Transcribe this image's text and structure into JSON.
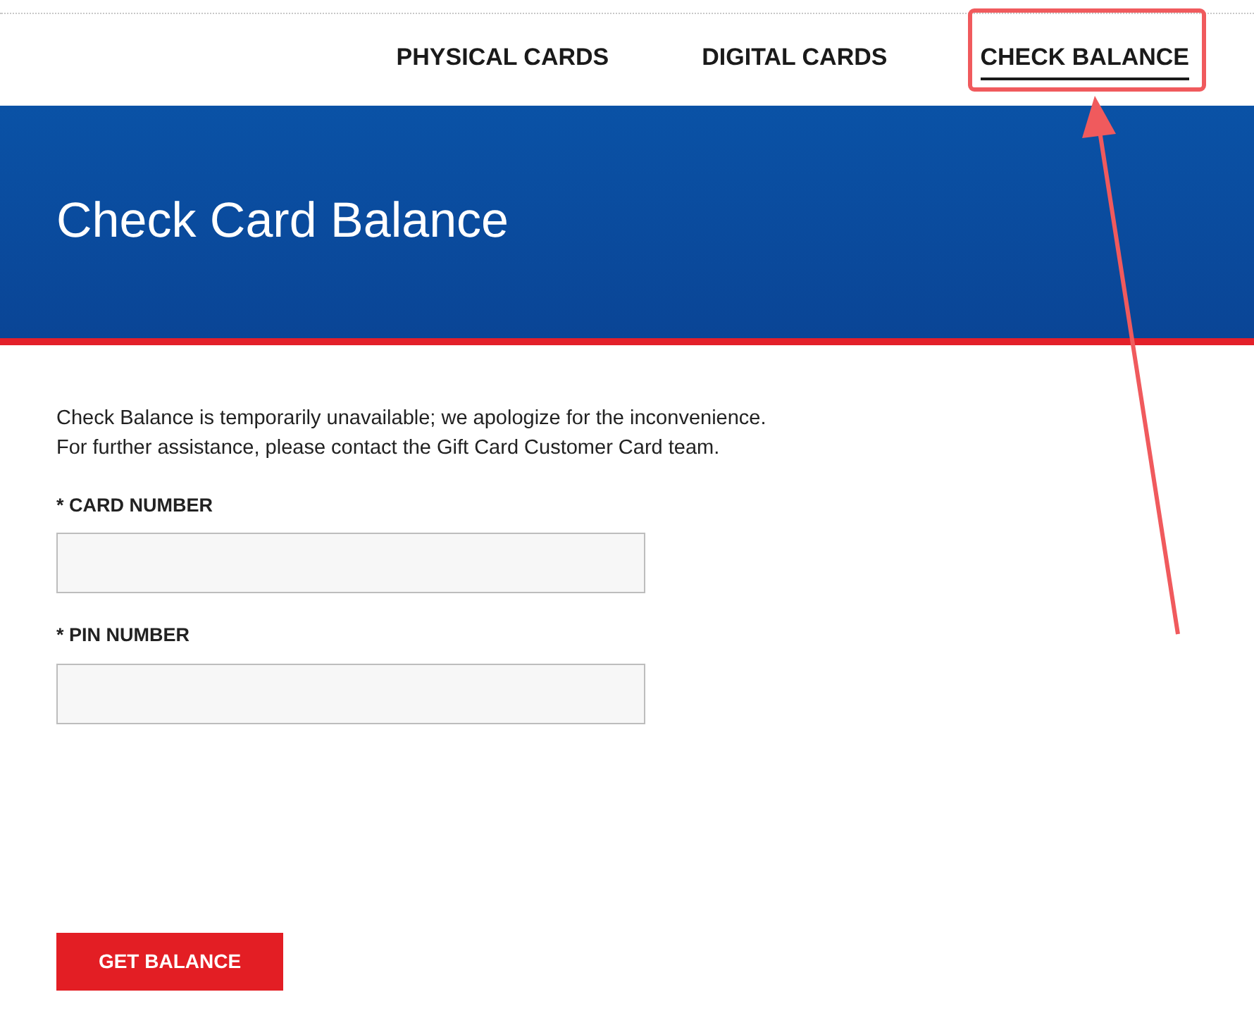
{
  "nav": {
    "tabs": [
      {
        "label": "PHYSICAL CARDS",
        "selected": false
      },
      {
        "label": "DIGITAL CARDS",
        "selected": false
      },
      {
        "label": "CHECK BALANCE",
        "selected": true
      }
    ]
  },
  "banner": {
    "title": "Check Card Balance"
  },
  "notice": [
    "Check Balance is temporarily unavailable; we apologize for the inconvenience.",
    "For further assistance, please contact the Gift Card Customer Card team."
  ],
  "fields": [
    {
      "label": "* CARD NUMBER"
    },
    {
      "label": "* PIN NUMBER"
    }
  ],
  "button": "GET BALANCE"
}
